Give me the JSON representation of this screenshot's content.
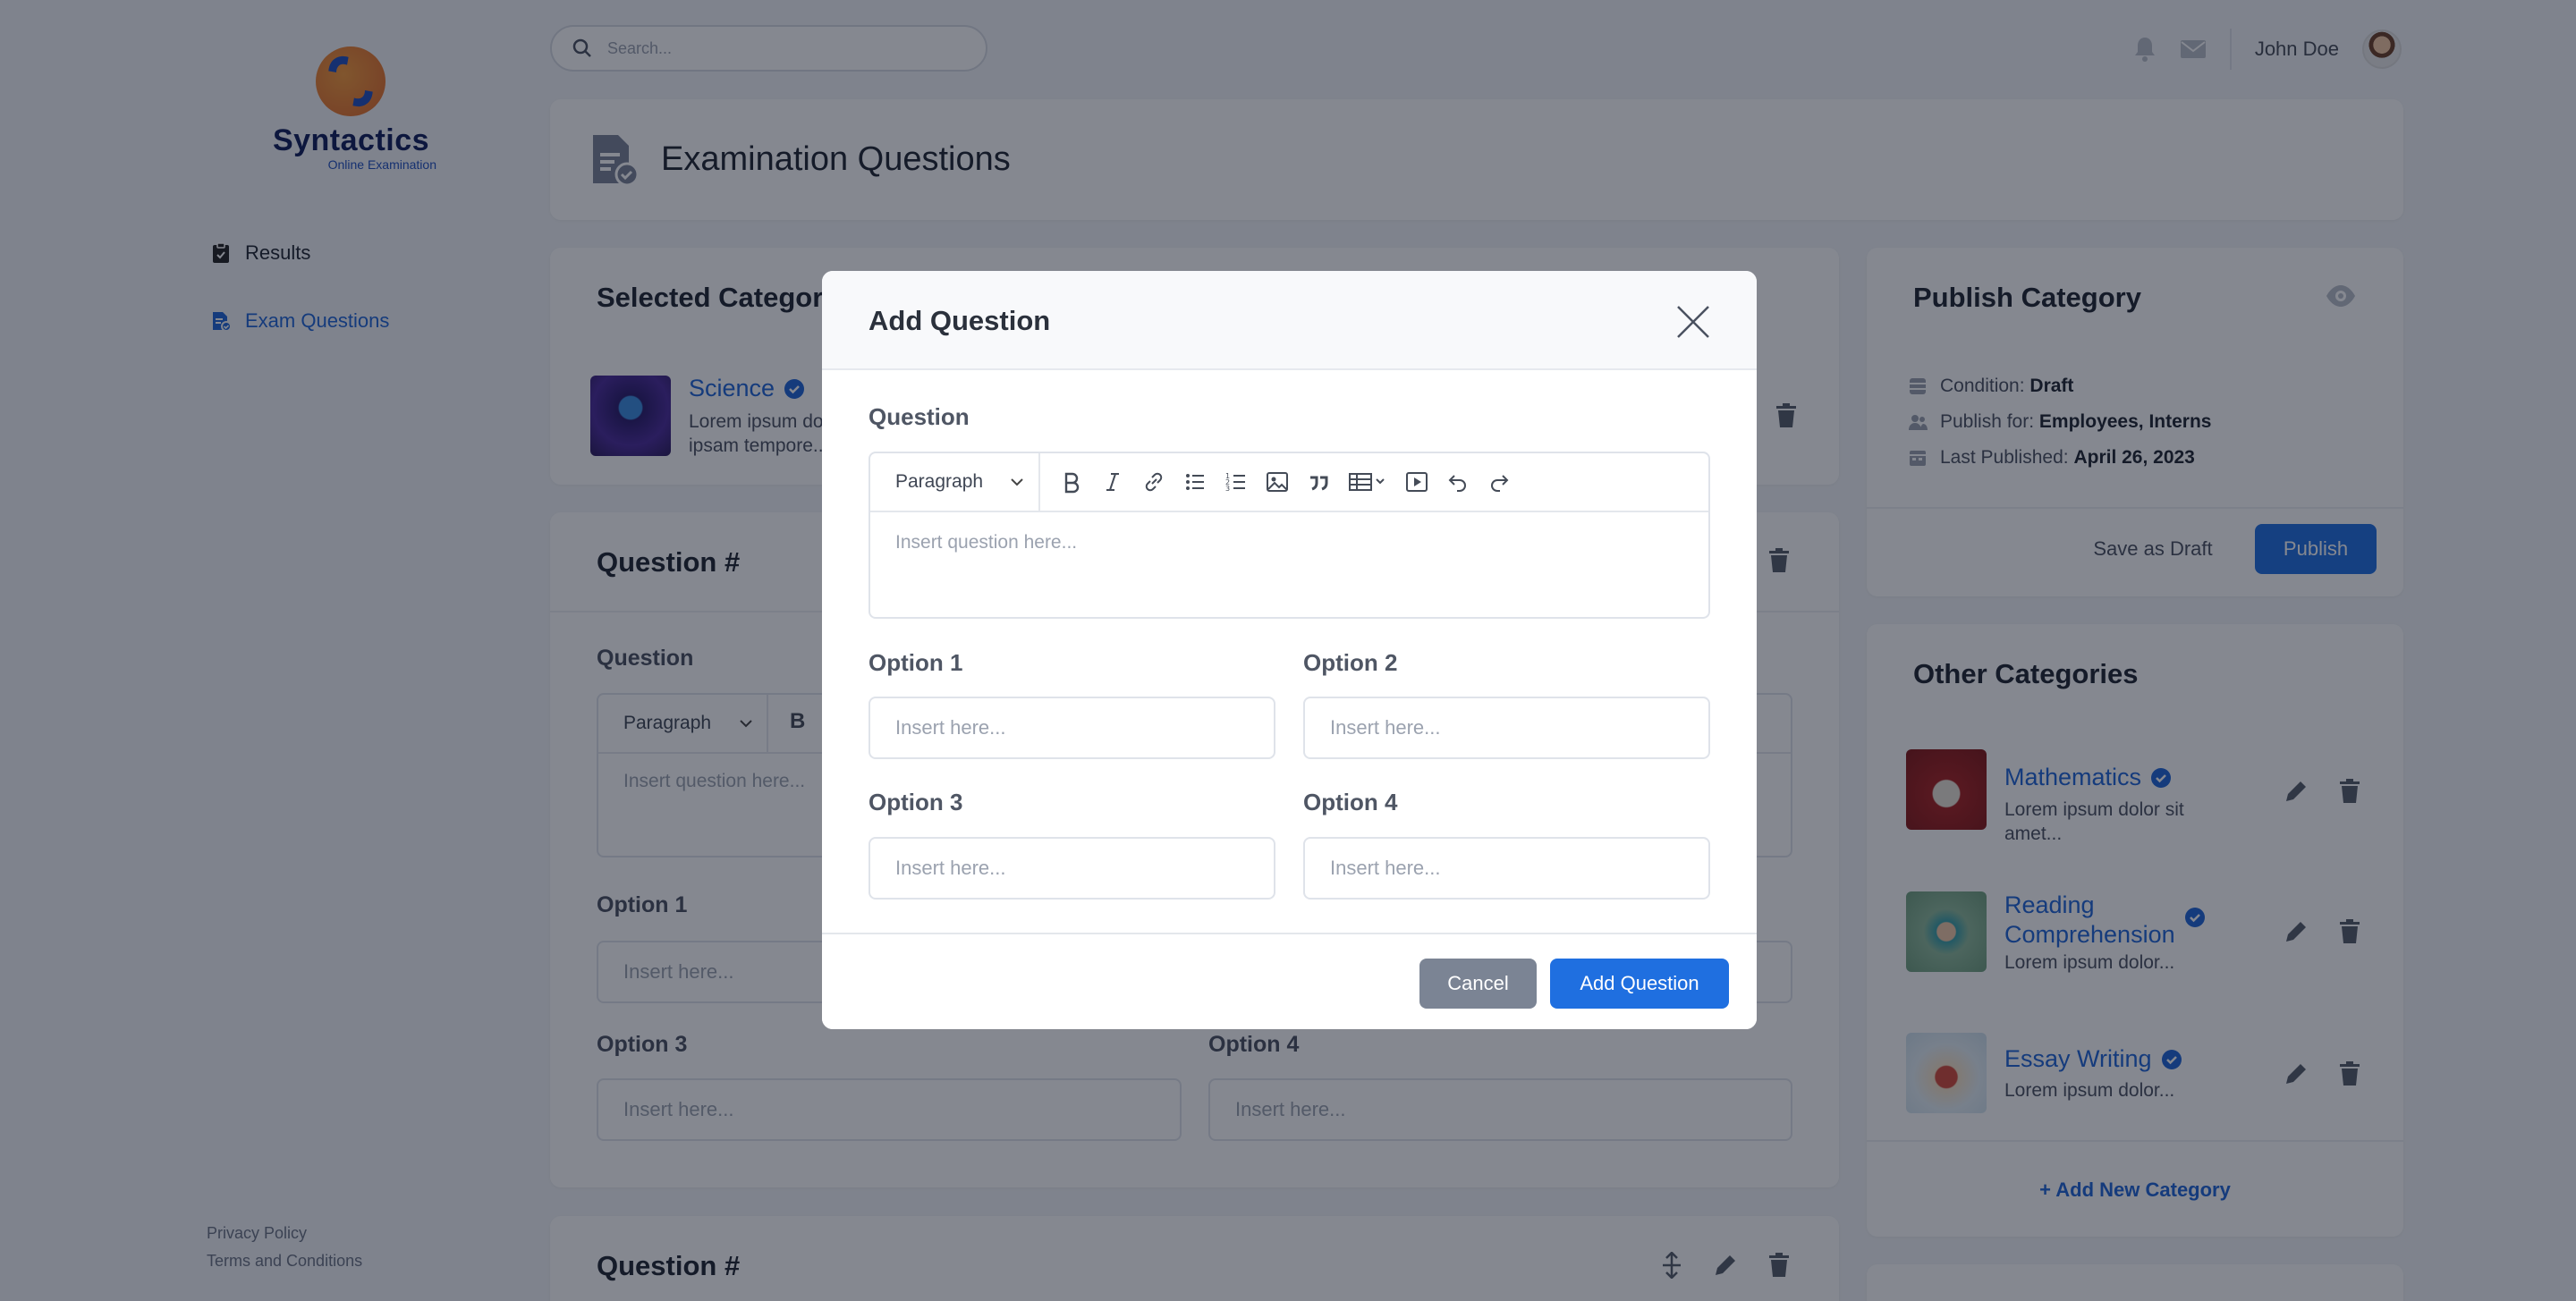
{
  "brand": {
    "name": "Syntactics",
    "tagline": "Online Examination"
  },
  "sidebar": {
    "items": [
      {
        "label": "Results",
        "active": false
      },
      {
        "label": "Exam Questions",
        "active": true
      }
    ],
    "footer": {
      "privacy": "Privacy Policy",
      "terms": "Terms and Conditions"
    }
  },
  "topbar": {
    "search_placeholder": "Search...",
    "user_name": "John Doe"
  },
  "page": {
    "title": "Examination Questions"
  },
  "selected_category": {
    "heading": "Selected Category",
    "name": "Science",
    "desc_line1": "Lorem ipsum dolor sit amet...",
    "desc_line2": "ipsam tempore..."
  },
  "question_block": {
    "heading": "Question #",
    "question_label": "Question",
    "paragraph": "Paragraph",
    "bold": "B",
    "question_placeholder": "Insert question here...",
    "option1_label": "Option 1",
    "option3_label": "Option 3",
    "option4_label": "Option 4",
    "input_placeholder": "Insert here..."
  },
  "question_block_2": {
    "heading": "Question #"
  },
  "publish": {
    "heading": "Publish Category",
    "condition_label": "Condition:",
    "condition_value": "Draft",
    "publish_for_label": "Publish for:",
    "publish_for_value": "Employees, Interns",
    "last_published_label": "Last Published:",
    "last_published_value": "April 26, 2023",
    "save_draft": "Save as Draft",
    "publish_button": "Publish"
  },
  "other_categories": {
    "heading": "Other Categories",
    "items": [
      {
        "name": "Mathematics",
        "desc_line1": "Lorem ipsum dolor sit",
        "desc_line2": "amet..."
      },
      {
        "name_line1": "Reading",
        "name_line2": "Comprehension",
        "desc_line1": "Lorem ipsum dolor..."
      },
      {
        "name": "Essay Writing",
        "desc_line1": "Lorem ipsum dolor..."
      }
    ],
    "add_new": "+ Add New Category"
  },
  "modal": {
    "title": "Add Question",
    "question_label": "Question",
    "paragraph": "Paragraph",
    "question_placeholder": "Insert question here...",
    "option1_label": "Option 1",
    "option2_label": "Option 2",
    "option3_label": "Option 3",
    "option4_label": "Option 4",
    "input_placeholder": "Insert here...",
    "cancel": "Cancel",
    "add": "Add Question"
  },
  "colors": {
    "accent": "#1f6fe0",
    "cancel": "#7b8494"
  }
}
